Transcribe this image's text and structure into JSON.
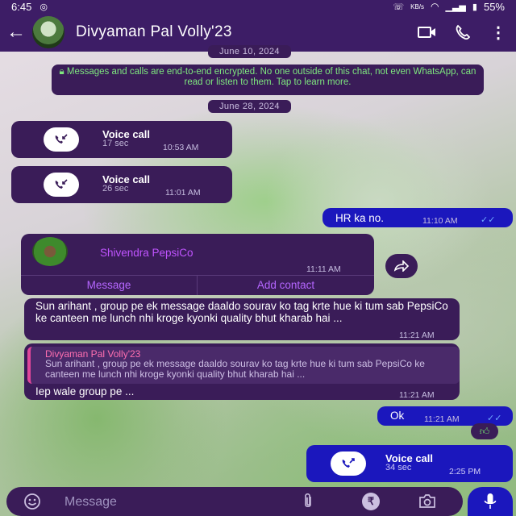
{
  "status": {
    "time": "6:45",
    "speed": "KB/s",
    "battery": "55%"
  },
  "header": {
    "contact_name": "Divyaman Pal Volly'23"
  },
  "chat": {
    "date1": "June 10, 2024",
    "encryption_notice": "Messages and calls are end-to-end encrypted. No one outside of this chat, not even WhatsApp, can read or listen to them. Tap to learn more.",
    "date2": "June 28, 2024",
    "call1": {
      "title": "Voice call",
      "duration": "17 sec",
      "time": "10:53 AM"
    },
    "call2": {
      "title": "Voice call",
      "duration": "26 sec",
      "time": "11:01 AM"
    },
    "msg_hr": {
      "text": "HR ka no.",
      "time": "11:10 AM"
    },
    "contact_card": {
      "name": "Shivendra PepsiCo",
      "time": "11:11 AM",
      "message_btn": "Message",
      "add_contact_btn": "Add contact"
    },
    "msg_sun": {
      "text": "Sun arihant , group pe ek message daaldo sourav ko tag krte hue ki tum sab PepsiCo ke canteen me lunch nhi kroge kyonki quality bhut kharab hai ...",
      "time": "11:21 AM"
    },
    "msg_reply": {
      "quote_name": "Divyaman Pal Volly'23",
      "quote_text": "Sun arihant , group pe ek message daaldo sourav ko tag krte hue ki tum sab PepsiCo ke canteen me lunch nhi kroge kyonki quality bhut kharab hai ...",
      "text": "Iep wale group pe ...",
      "time": "11:21 AM"
    },
    "msg_ok": {
      "text": "Ok",
      "time": "11:21 AM"
    },
    "call3": {
      "title": "Voice call",
      "duration": "34 sec",
      "time": "2:25 PM"
    }
  },
  "input": {
    "placeholder": "Message"
  },
  "colors": {
    "bar": "#3d1d66",
    "incoming_bubble": "#3a1c58",
    "outgoing_bubble": "#1b17bd",
    "accent_green": "#7ee77e",
    "contact_purple": "#c054ff"
  },
  "icons": [
    "back-arrow-icon",
    "video-call-icon",
    "phone-icon",
    "more-vert-icon",
    "lock-icon",
    "incoming-call-icon",
    "outgoing-call-icon",
    "double-check-icon",
    "forward-icon",
    "thumbs-up-icon",
    "emoji-icon",
    "attach-icon",
    "rupee-icon",
    "camera-icon",
    "mic-icon"
  ]
}
